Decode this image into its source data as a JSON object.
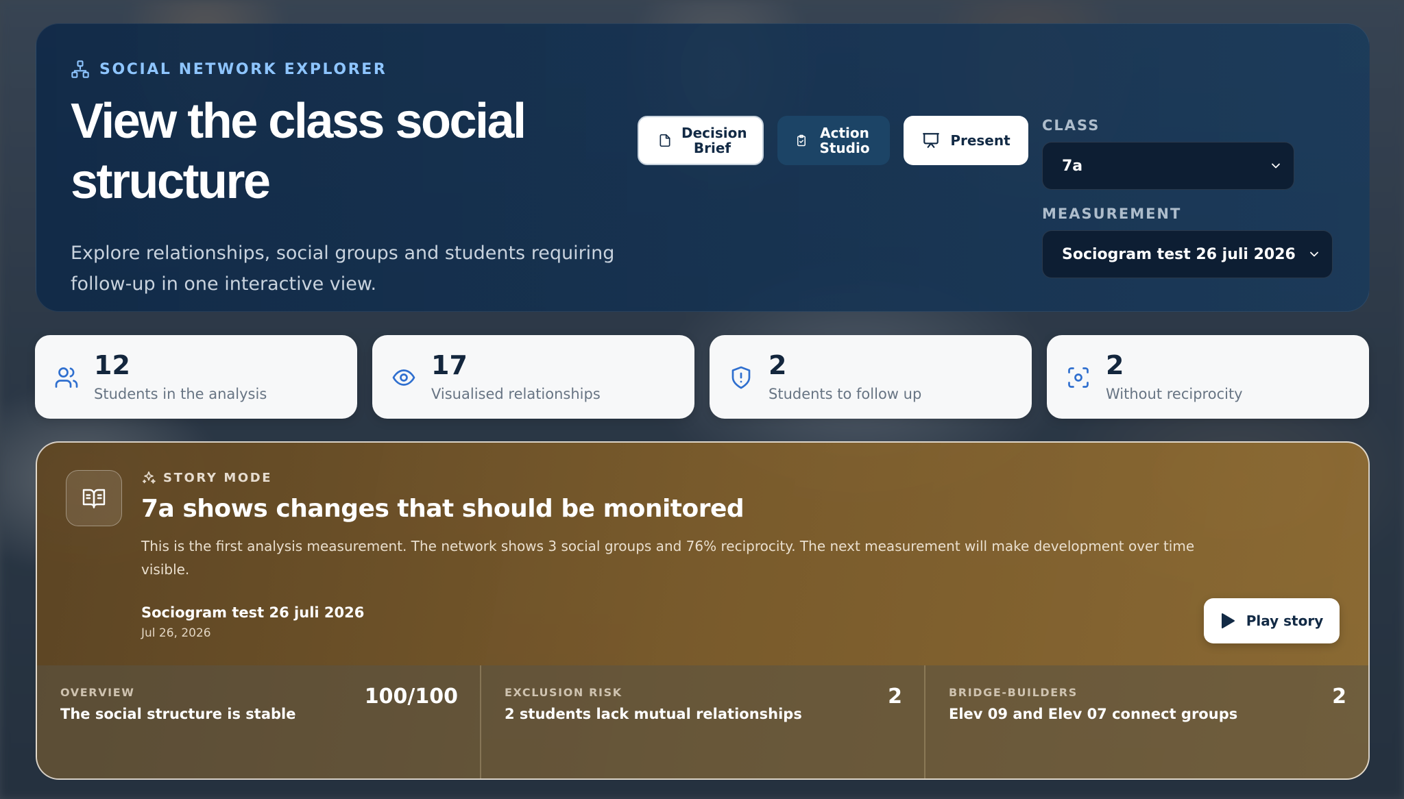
{
  "hero": {
    "eyebrow": "SOCIAL NETWORK EXPLORER",
    "title": "View the class social structure",
    "subtitle": "Explore relationships, social groups and students requiring follow-up in one interactive view.",
    "buttons": {
      "decision_brief": "Decision Brief",
      "action_studio": "Action Studio",
      "present": "Present"
    },
    "class_label": "CLASS",
    "class_value": "7a",
    "measurement_label": "MEASUREMENT",
    "measurement_value": "Sociogram test 26 juli 2026"
  },
  "stats": [
    {
      "value": "12",
      "label": "Students in the analysis",
      "icon": "users-icon"
    },
    {
      "value": "17",
      "label": "Visualised relationships",
      "icon": "eye-icon"
    },
    {
      "value": "2",
      "label": "Students to follow up",
      "icon": "shield-alert-icon"
    },
    {
      "value": "2",
      "label": "Without reciprocity",
      "icon": "focus-icon"
    }
  ],
  "story": {
    "eyebrow": "STORY MODE",
    "title": "7a shows changes that should be monitored",
    "description": "This is the first analysis measurement. The network shows 3 social groups and 76% reciprocity. The next measurement will make development over time visible.",
    "measurement": "Sociogram test 26 juli 2026",
    "date": "Jul 26, 2026",
    "play_label": "Play story",
    "metrics": [
      {
        "kicker": "OVERVIEW",
        "text": "The social structure is stable",
        "value": "100/100"
      },
      {
        "kicker": "EXCLUSION RISK",
        "text": "2 students lack mutual relationships",
        "value": "2"
      },
      {
        "kicker": "BRIDGE-BUILDERS",
        "text": "Elev 09 and Elev 07 connect groups",
        "value": "2"
      }
    ]
  },
  "colors": {
    "accent": "#8ec5ff",
    "navy": "#122a45",
    "stat_icon": "#2f6fcf",
    "story_gold": "#8a6a2e"
  }
}
